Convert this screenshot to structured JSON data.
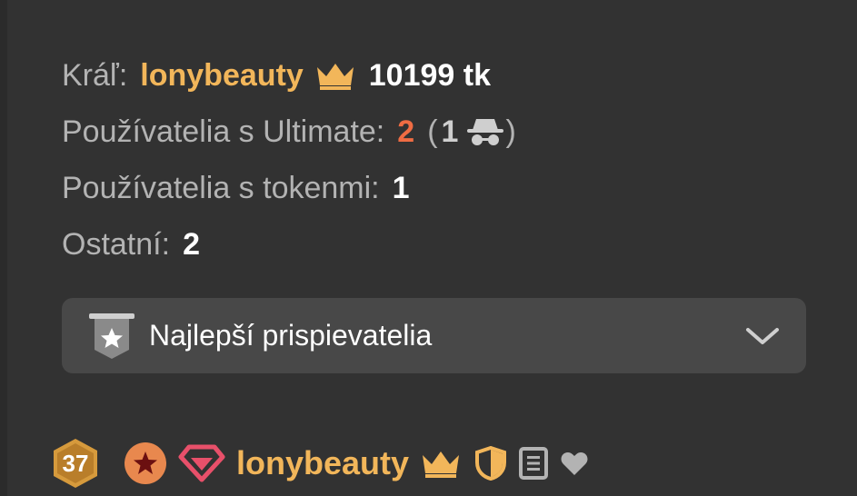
{
  "stats": {
    "king_label": "Kráľ:",
    "king_name": "lonybeauty",
    "king_tokens": "10199 tk",
    "ultimate_label": "Používatelia s Ultimate:",
    "ultimate_count": "2",
    "anon_open": "(",
    "anon_count": "1",
    "anon_close": ")",
    "tokens_label": "Používatelia s tokenmi:",
    "tokens_count": "1",
    "others_label": "Ostatní:",
    "others_count": "2"
  },
  "accordion": {
    "label": "Najlepší prispievatelia",
    "icon": "star-badge-icon",
    "chevron": "chevron-down-icon"
  },
  "user": {
    "level": "37",
    "name": "lonybeauty",
    "icons": [
      "star-badge-icon",
      "gem-icon",
      "crown-icon",
      "shield-icon",
      "document-icon",
      "heart-icon"
    ]
  },
  "colors": {
    "background": "#323232",
    "panel": "#484848",
    "gold": "#f2b65a",
    "orange": "#ef6c43",
    "text_muted": "#b3b3b3",
    "text_bright": "#ffffff"
  }
}
